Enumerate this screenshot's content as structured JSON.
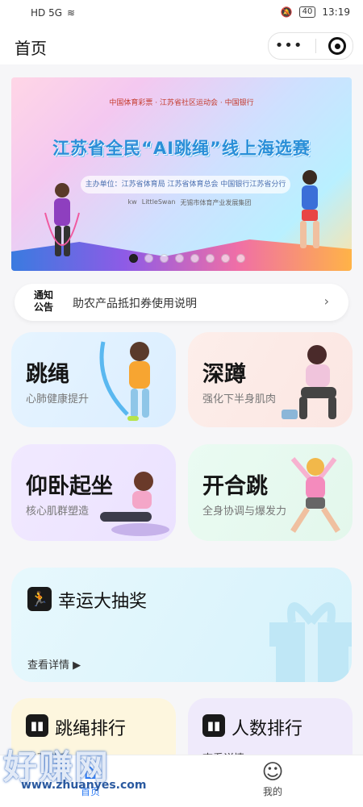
{
  "status_bar": {
    "left": "HD 5G",
    "battery": "40",
    "time": "13:19"
  },
  "nav": {
    "title": "首页"
  },
  "banner": {
    "sponsors": "中国体育彩票 · 江苏省社区运动会 · 中国银行",
    "title": "江苏省全民“AI跳绳”线上海选赛",
    "organizers": "主办单位：江苏省体育局 江苏省体育总会 中国银行江苏省分行",
    "logos": [
      "kw",
      "LittleSwan",
      "无锡市体育产业发展集团"
    ],
    "page_index": 1,
    "page_count": 8
  },
  "notice": {
    "tag_line1": "通知",
    "tag_line2": "公告",
    "text": "助农产品抵扣券使用说明"
  },
  "cards": [
    {
      "title": "跳绳",
      "subtitle": "心肺健康提升"
    },
    {
      "title": "深蹲",
      "subtitle": "强化下半身肌肉"
    },
    {
      "title": "仰卧起坐",
      "subtitle": "核心肌群塑造"
    },
    {
      "title": "开合跳",
      "subtitle": "全身协调与爆发力"
    }
  ],
  "lottery": {
    "title": "幸运大抽奖",
    "more": "查看详情"
  },
  "rankings": [
    {
      "title": "跳绳排行",
      "more": "查看详情"
    },
    {
      "title": "人数排行",
      "more": "查看详情"
    }
  ],
  "tabbar": {
    "home": "首页",
    "mine": "我的"
  },
  "watermark": {
    "text": "好赚网",
    "url": "www.zhuanyes.com"
  },
  "colors": {
    "accent": "#2f7df6"
  }
}
